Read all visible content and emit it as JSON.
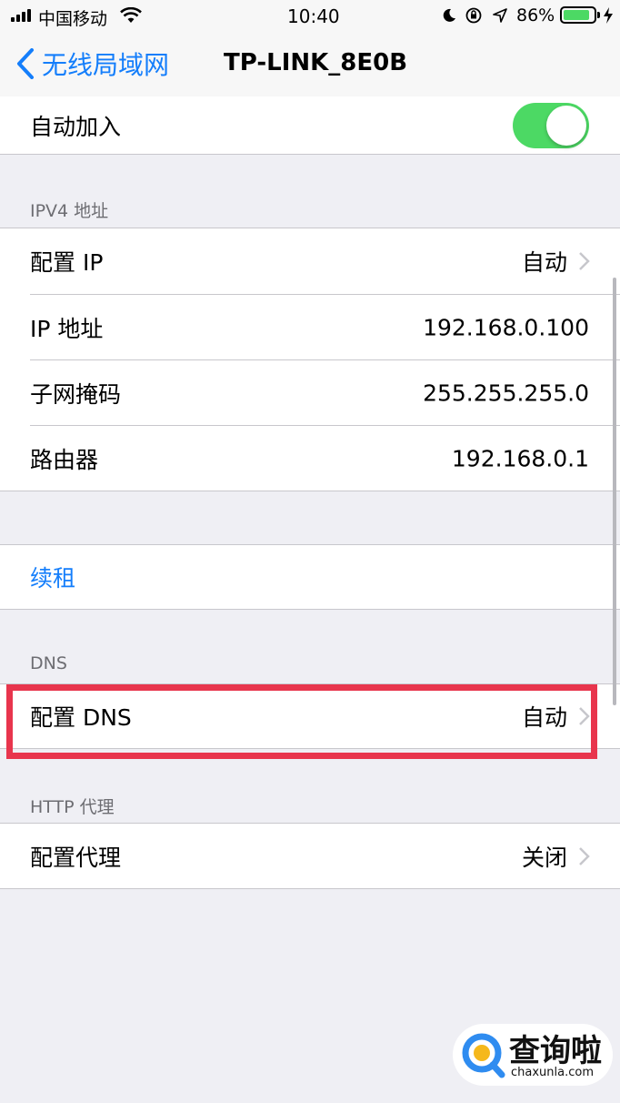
{
  "status_bar": {
    "carrier": "中国移动",
    "time": "10:40",
    "battery_percent": "86%",
    "battery_level": 0.86
  },
  "nav": {
    "back_label": "无线局域网",
    "title": "TP-LINK_8E0B"
  },
  "auto_join": {
    "label": "自动加入",
    "enabled": true
  },
  "ipv4": {
    "header": "IPV4 地址",
    "rows": [
      {
        "label": "配置 IP",
        "value": "自动"
      },
      {
        "label": "IP 地址",
        "value": "192.168.0.100"
      },
      {
        "label": "子网掩码",
        "value": "255.255.255.0"
      },
      {
        "label": "路由器",
        "value": "192.168.0.1"
      }
    ]
  },
  "renew": {
    "label": "续租",
    "color": "#147efb"
  },
  "dns": {
    "header": "DNS",
    "configure_label": "配置 DNS",
    "configure_value": "自动",
    "highlight_color": "#e8354d"
  },
  "http_proxy": {
    "header": "HTTP 代理",
    "configure_label": "配置代理",
    "configure_value": "关闭"
  },
  "watermark": {
    "logo_text": "查询啦",
    "domain": "chaxunla.com"
  },
  "colors": {
    "accent": "#147efb",
    "toggle_on": "#4cd964",
    "background": "#efeff4"
  }
}
